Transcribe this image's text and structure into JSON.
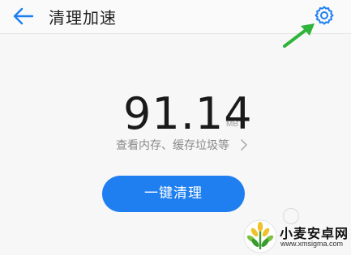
{
  "header": {
    "title": "清理加速",
    "back_icon": "arrow-left-icon",
    "settings_icon": "gear-icon"
  },
  "storage": {
    "value": "91.14",
    "unit": "MB",
    "detail_label": "查看内存、缓存垃圾等",
    "detail_icon": "chevron-right-icon"
  },
  "actions": {
    "clean_label": "一键清理"
  },
  "watermark": {
    "name": "小麦安卓网",
    "url": "www.xmsigma.com"
  },
  "colors": {
    "accent": "#1f7ff0",
    "annotation_arrow": "#2fb33a"
  }
}
